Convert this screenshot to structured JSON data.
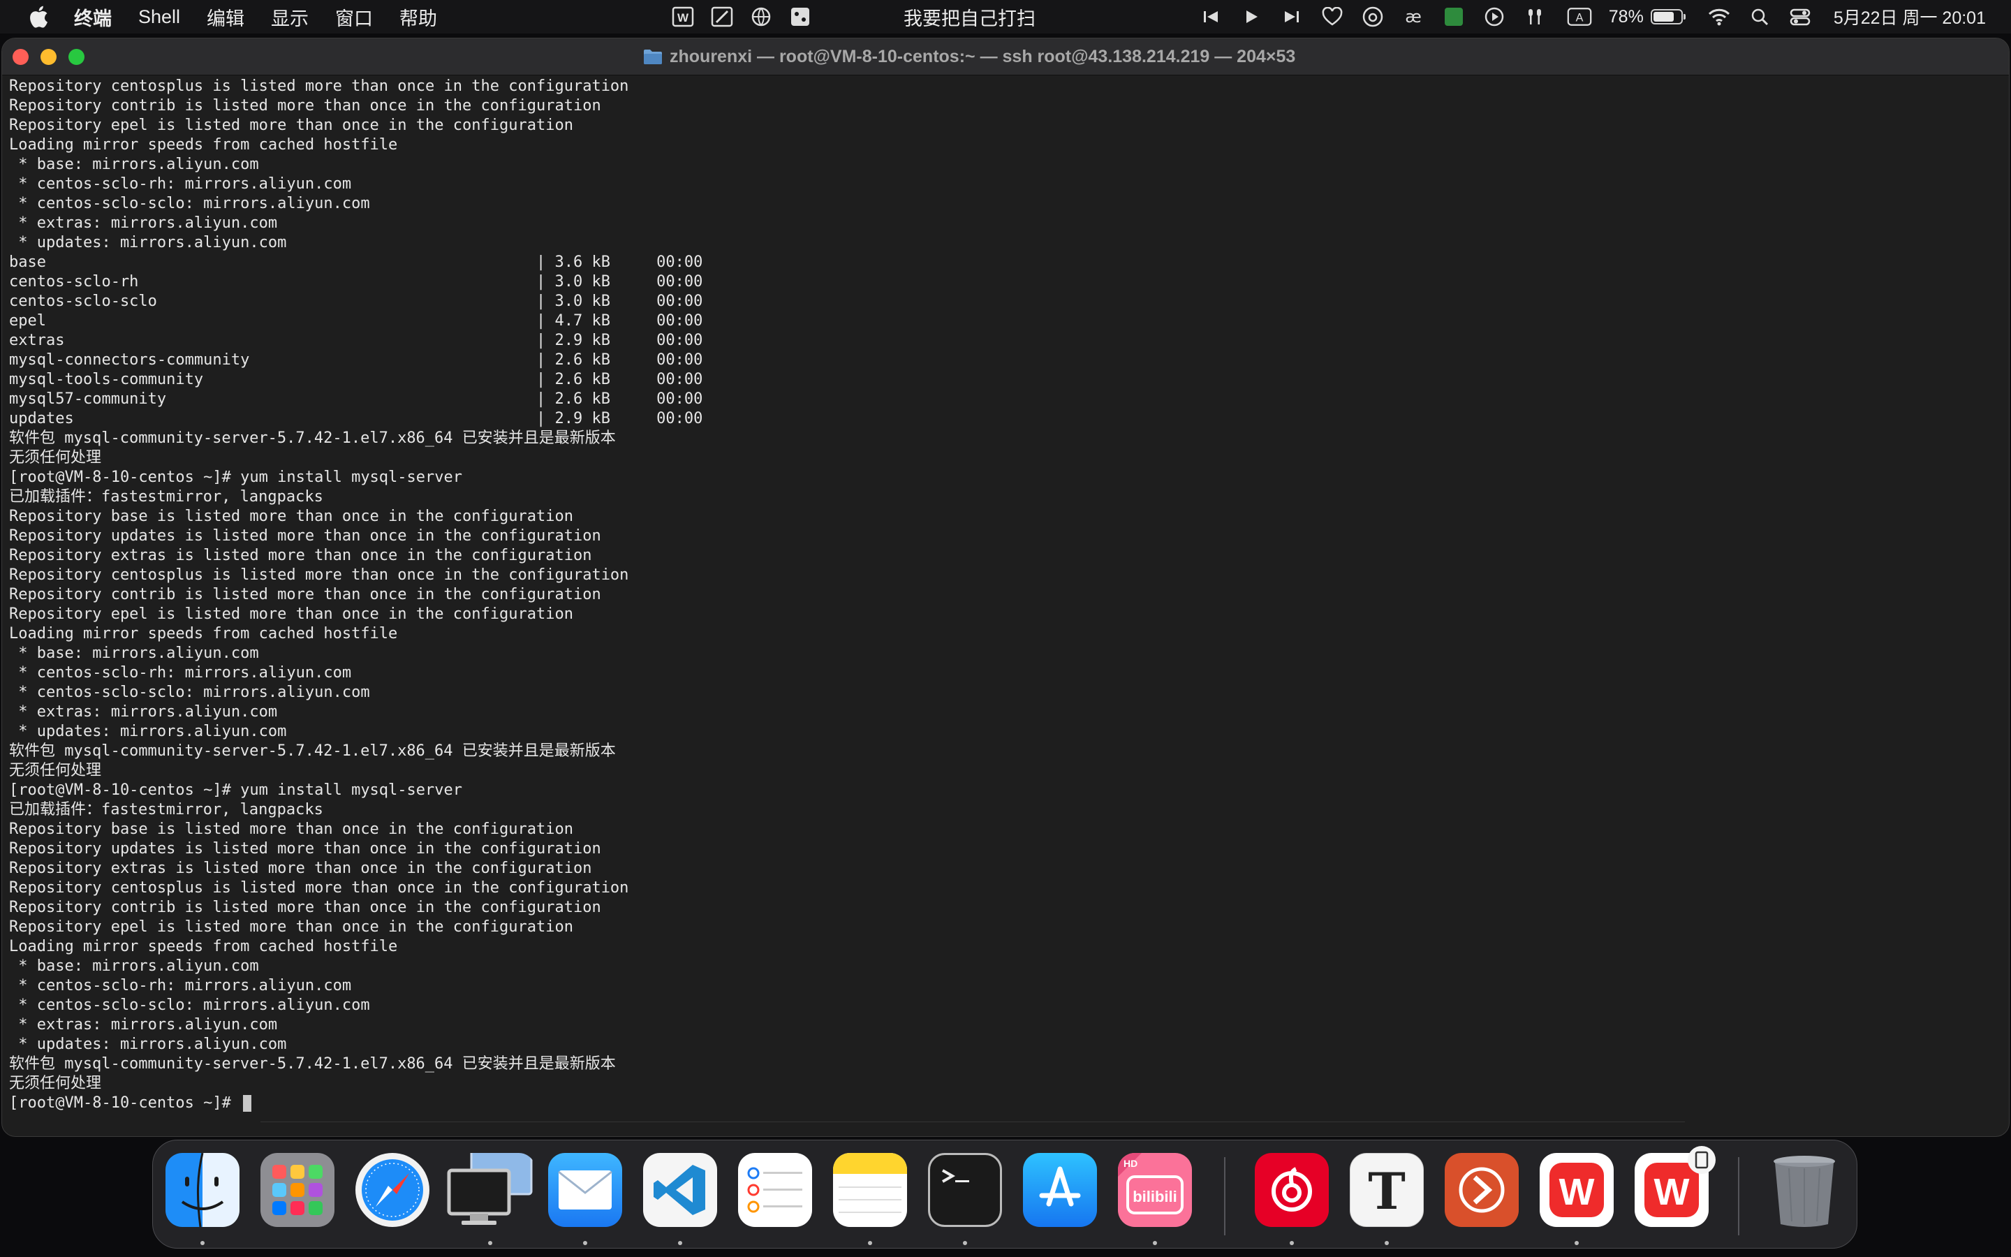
{
  "menubar": {
    "app_name": "终端",
    "menus": [
      "Shell",
      "编辑",
      "显示",
      "窗口",
      "帮助"
    ],
    "lyric": "我要把自己打扫",
    "battery_percent": "78%",
    "battery_level": 0.78,
    "datetime": "5月22日 周一  20:01",
    "input_method": "A"
  },
  "window": {
    "title": "zhourenxi — root@VM-8-10-centos:~ — ssh root@43.138.214.219 — 204×53"
  },
  "terminal": {
    "lines": [
      "Repository centosplus is listed more than once in the configuration",
      "Repository contrib is listed more than once in the configuration",
      "Repository epel is listed more than once in the configuration",
      "Loading mirror speeds from cached hostfile",
      " * base: mirrors.aliyun.com",
      " * centos-sclo-rh: mirrors.aliyun.com",
      " * centos-sclo-sclo: mirrors.aliyun.com",
      " * extras: mirrors.aliyun.com",
      " * updates: mirrors.aliyun.com",
      "base                                                     | 3.6 kB     00:00",
      "centos-sclo-rh                                           | 3.0 kB     00:00",
      "centos-sclo-sclo                                         | 3.0 kB     00:00",
      "epel                                                     | 4.7 kB     00:00",
      "extras                                                   | 2.9 kB     00:00",
      "mysql-connectors-community                               | 2.6 kB     00:00",
      "mysql-tools-community                                    | 2.6 kB     00:00",
      "mysql57-community                                        | 2.6 kB     00:00",
      "updates                                                  | 2.9 kB     00:00",
      "软件包 mysql-community-server-5.7.42-1.el7.x86_64 已安装并且是最新版本",
      "无须任何处理",
      "[root@VM-8-10-centos ~]# yum install mysql-server",
      "已加载插件：fastestmirror, langpacks",
      "Repository base is listed more than once in the configuration",
      "Repository updates is listed more than once in the configuration",
      "Repository extras is listed more than once in the configuration",
      "Repository centosplus is listed more than once in the configuration",
      "Repository contrib is listed more than once in the configuration",
      "Repository epel is listed more than once in the configuration",
      "Loading mirror speeds from cached hostfile",
      " * base: mirrors.aliyun.com",
      " * centos-sclo-rh: mirrors.aliyun.com",
      " * centos-sclo-sclo: mirrors.aliyun.com",
      " * extras: mirrors.aliyun.com",
      " * updates: mirrors.aliyun.com",
      "软件包 mysql-community-server-5.7.42-1.el7.x86_64 已安装并且是最新版本",
      "无须任何处理",
      "[root@VM-8-10-centos ~]# yum install mysql-server",
      "已加载插件：fastestmirror, langpacks",
      "Repository base is listed more than once in the configuration",
      "Repository updates is listed more than once in the configuration",
      "Repository extras is listed more than once in the configuration",
      "Repository centosplus is listed more than once in the configuration",
      "Repository contrib is listed more than once in the configuration",
      "Repository epel is listed more than once in the configuration",
      "Loading mirror speeds from cached hostfile",
      " * base: mirrors.aliyun.com",
      " * centos-sclo-rh: mirrors.aliyun.com",
      " * centos-sclo-sclo: mirrors.aliyun.com",
      " * extras: mirrors.aliyun.com",
      " * updates: mirrors.aliyun.com",
      "软件包 mysql-community-server-5.7.42-1.el7.x86_64 已安装并且是最新版本",
      "无须任何处理"
    ],
    "prompt": "[root@VM-8-10-centos ~]# "
  },
  "dock": {
    "items": [
      {
        "name": "finder",
        "icon": "finder-icon",
        "running": true
      },
      {
        "name": "launchpad",
        "icon": "launchpad-icon",
        "running": false
      },
      {
        "name": "safari",
        "icon": "safari-icon",
        "running": false
      },
      {
        "name": "screen-sharing",
        "icon": "screen-sharing-icon",
        "running": true
      },
      {
        "name": "mail",
        "icon": "mail-icon",
        "running": true
      },
      {
        "name": "vscode",
        "icon": "vscode-icon",
        "running": true
      },
      {
        "name": "reminders",
        "icon": "reminders-icon",
        "running": false
      },
      {
        "name": "notes",
        "icon": "notes-icon",
        "running": true
      },
      {
        "name": "terminal",
        "icon": "terminal-icon",
        "running": true
      },
      {
        "name": "app-store",
        "icon": "app-store-icon",
        "running": false
      },
      {
        "name": "bilibili",
        "icon": "bilibili-icon",
        "label": "bilibili",
        "badge": "HD",
        "running": true
      },
      {
        "name": "netease-music",
        "icon": "netease-music-icon",
        "running": true
      },
      {
        "name": "typora",
        "icon": "typora-icon",
        "label": "T",
        "running": true
      },
      {
        "name": "remote-desktop",
        "icon": "remote-desktop-icon",
        "running": false
      },
      {
        "name": "wps",
        "icon": "wps-icon",
        "label": "W",
        "running": true
      },
      {
        "name": "wps-pdf",
        "icon": "wps-pdf-icon",
        "label": "W",
        "running": false
      },
      {
        "name": "trash",
        "icon": "trash-icon",
        "running": false
      }
    ]
  },
  "colors": {
    "terminal_bg": "#1e1e1e",
    "terminal_fg": "#e6e6e6",
    "close": "#ff5f57",
    "minimize": "#febc2e",
    "zoom": "#28c840"
  }
}
